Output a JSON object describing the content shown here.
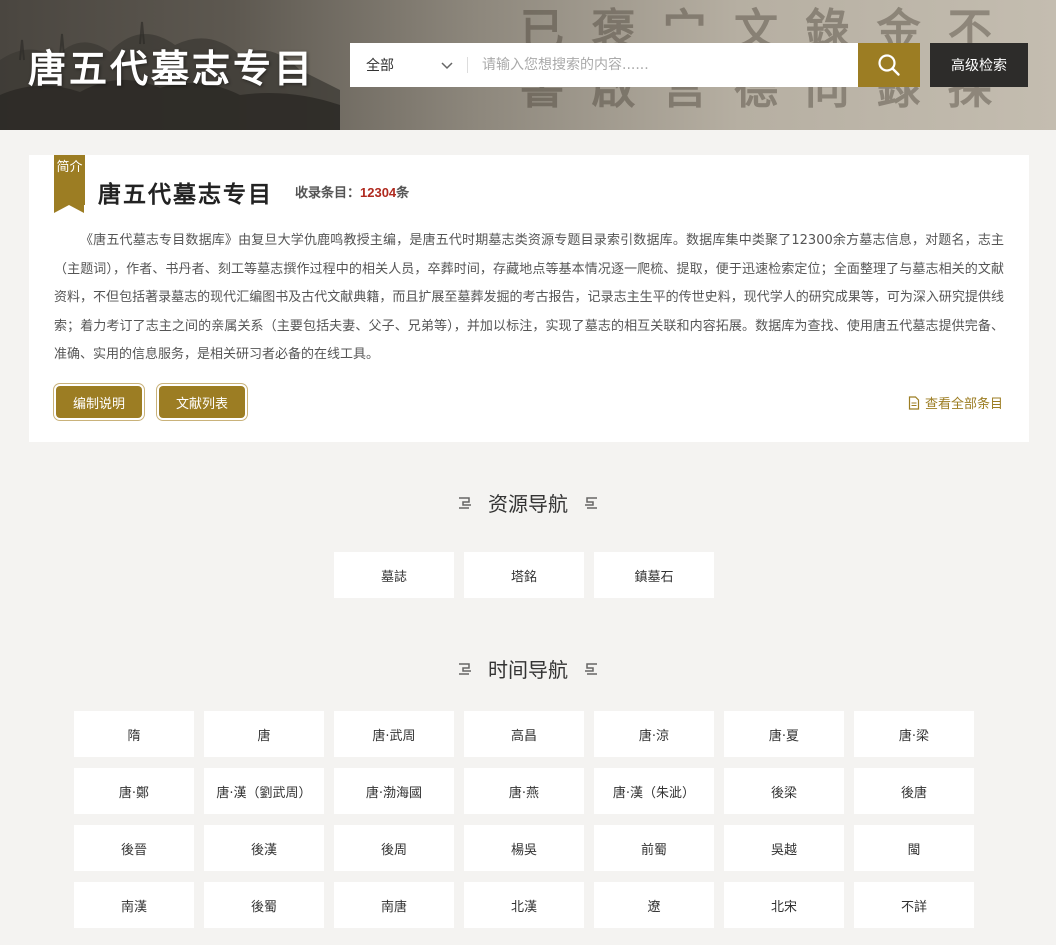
{
  "header": {
    "site_title": "唐五代墓志专目",
    "scope_value": "全部",
    "search_placeholder": "请输入您想搜索的内容......",
    "advanced_label": "高级检索"
  },
  "intro": {
    "badge": "简介",
    "title": "唐五代墓志专目",
    "count_label": "收录条目：",
    "count_value": "12304",
    "count_unit": "条",
    "description": "《唐五代墓志专目数据库》由复旦大学仇鹿鸣教授主编，是唐五代时期墓志类资源专题目录索引数据库。数据库集中类聚了12300余方墓志信息，对题名，志主（主题词），作者、书丹者、刻工等墓志撰作过程中的相关人员，卒葬时间，存藏地点等基本情况逐一爬梳、提取，便于迅速检索定位；全面整理了与墓志相关的文献资料，不但包括著录墓志的现代汇编图书及古代文献典籍，而且扩展至墓葬发掘的考古报告，记录志主生平的传世史料，现代学人的研究成果等，可为深入研究提供线索；着力考订了志主之间的亲属关系（主要包括夫妻、父子、兄弟等），并加以标注，实现了墓志的相互关联和内容拓展。数据库为查找、使用唐五代墓志提供完备、准确、实用的信息服务，是相关研习者必备的在线工具。",
    "btn_compile": "编制说明",
    "btn_literature": "文献列表",
    "view_all": "查看全部条目"
  },
  "resource_nav": {
    "heading": "资源导航",
    "items": [
      "墓誌",
      "塔銘",
      "鎮墓石"
    ]
  },
  "time_nav": {
    "heading": "时间导航",
    "items": [
      "隋",
      "唐",
      "唐·武周",
      "高昌",
      "唐·涼",
      "唐·夏",
      "唐·梁",
      "唐·鄭",
      "唐·漢（劉武周）",
      "唐·渤海國",
      "唐·燕",
      "唐·漢（朱泚）",
      "後梁",
      "後唐",
      "後晉",
      "後漢",
      "後周",
      "楊吳",
      "前蜀",
      "吳越",
      "閩",
      "南漢",
      "後蜀",
      "南唐",
      "北漢",
      "遼",
      "北宋",
      "不詳"
    ]
  },
  "colors": {
    "accent": "#9c7d23",
    "dark_button": "#2d2c2a",
    "count_red": "#b02a1f",
    "page_bg": "#f4f3f1"
  },
  "icons": {
    "search": "search-icon",
    "dropdown": "chevron-down-icon",
    "document": "document-icon",
    "section_ornament": "fret-ornament-icon"
  }
}
